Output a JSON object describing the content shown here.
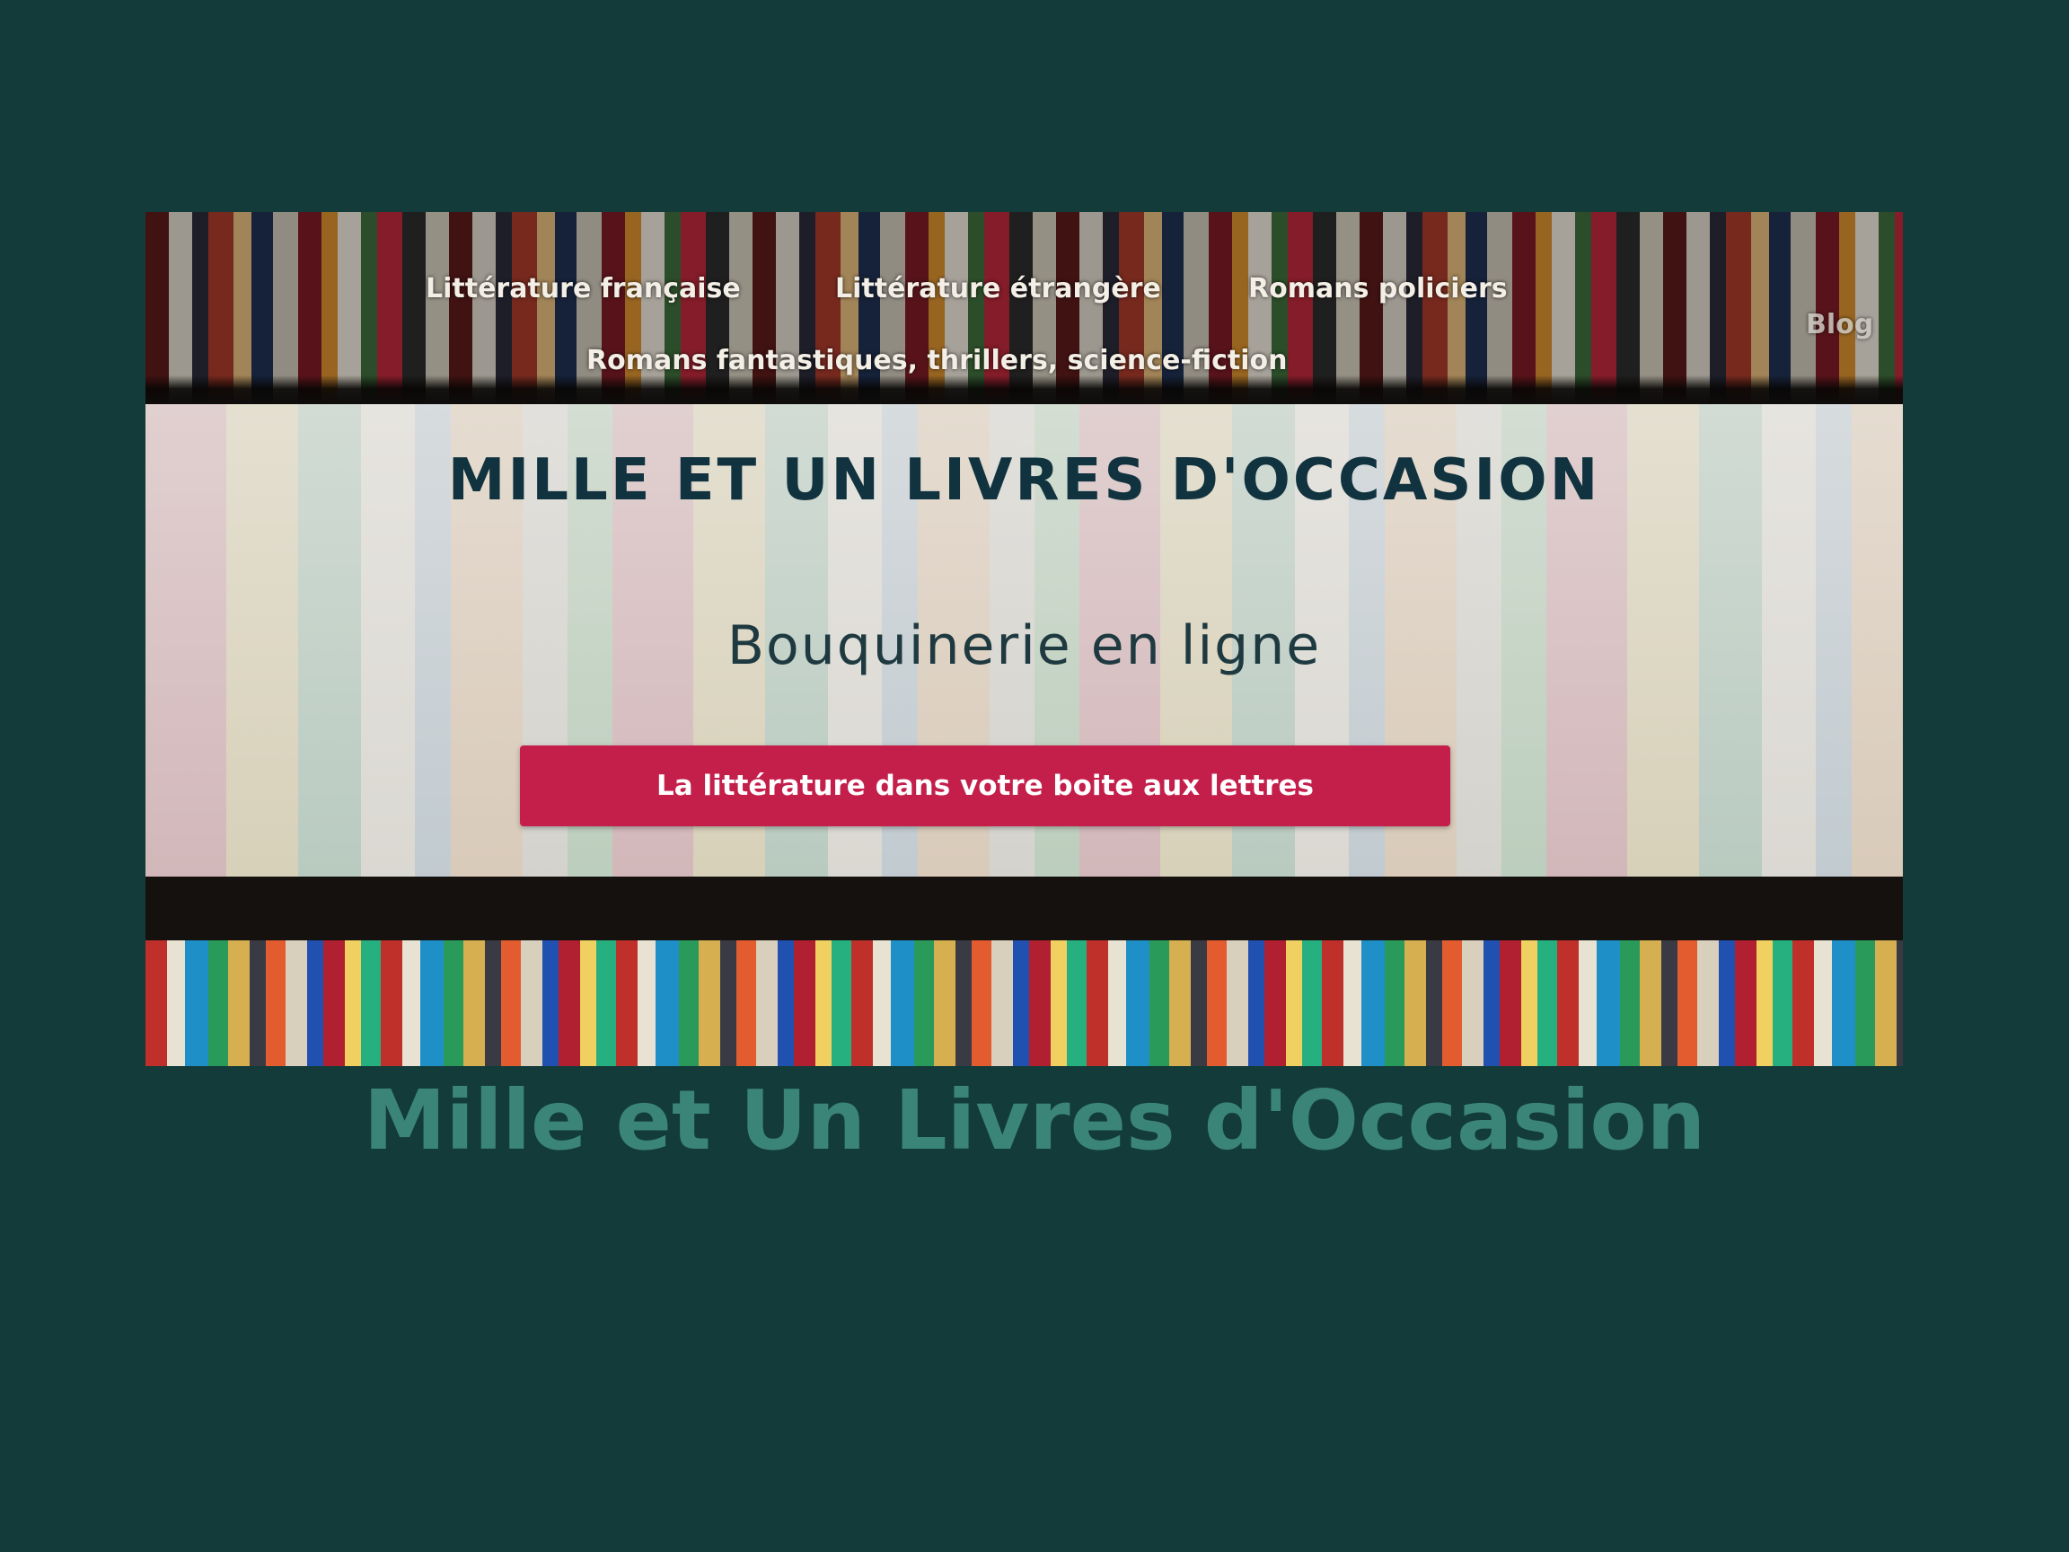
{
  "banner": {
    "nav": {
      "litterature_francaise": "Littérature française",
      "litterature_etrangere": "Littérature étrangère",
      "romans_policiers": "Romans policiers",
      "romans_fantastiques": "Romans fantastiques, thrillers, science-fiction",
      "blog": "Blog"
    },
    "logo_title": "MILLE ET UN LIVRES D'OCCASION",
    "tagline": "Bouquinerie en ligne",
    "cta_label": "La littérature dans votre boite aux lettres"
  },
  "site_title": "Mille et Un Livres d'Occasion",
  "colors": {
    "background": "#123b39",
    "site_title": "#3b8478",
    "cta": "#c41f4b",
    "logo_title": "#11333f"
  }
}
